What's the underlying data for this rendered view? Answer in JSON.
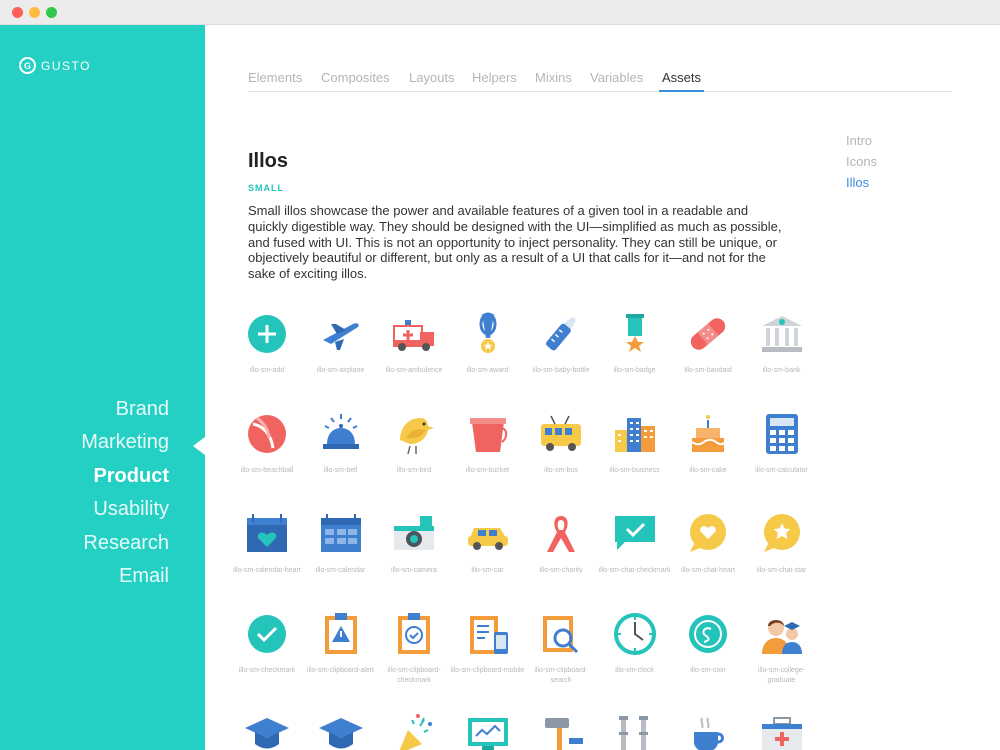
{
  "window": {
    "title": ""
  },
  "sidebar": {
    "logo_mark": "G",
    "logo_text": "GUSTO",
    "nav": [
      {
        "label": "Brand",
        "active": false
      },
      {
        "label": "Marketing",
        "active": false
      },
      {
        "label": "Product",
        "active": true
      },
      {
        "label": "Usability",
        "active": false
      },
      {
        "label": "Research",
        "active": false
      },
      {
        "label": "Email",
        "active": false
      }
    ]
  },
  "tabs": [
    {
      "label": "Elements",
      "active": false
    },
    {
      "label": "Composites",
      "active": false
    },
    {
      "label": "Layouts",
      "active": false
    },
    {
      "label": "Helpers",
      "active": false
    },
    {
      "label": "Mixins",
      "active": false
    },
    {
      "label": "Variables",
      "active": false
    },
    {
      "label": "Assets",
      "active": true
    }
  ],
  "right_nav": [
    {
      "label": "Intro",
      "active": false
    },
    {
      "label": "Icons",
      "active": false
    },
    {
      "label": "Illos",
      "active": true
    }
  ],
  "main": {
    "title": "Illos",
    "subtitle": "SMALL",
    "description": "Small illos showcase the power and available features of a given tool in a readable and quickly digestible way. They should be designed with the UI—simplified as much as possible, and fused with UI. This is not an opportunity to inject personality. They can still be unique, or objectively beautiful or different, but only as a result of a UI that calls for it—and not for the sake of exciting illos."
  },
  "colors": {
    "sidebar": "#24d0c4",
    "accent_blue": "#3a8ee0",
    "teal": "#24c4bb",
    "blue": "#3f7fd0",
    "red": "#f0635f",
    "yellow": "#f7c948",
    "orange": "#f39c3c",
    "gray": "#cfd4d8"
  },
  "illos": [
    {
      "label": "illo-sm-add",
      "icon": "add-icon"
    },
    {
      "label": "illo-sm-airplane",
      "icon": "airplane-icon"
    },
    {
      "label": "illo-sm-ambulence",
      "icon": "ambulance-icon"
    },
    {
      "label": "illo-sm-award",
      "icon": "award-icon"
    },
    {
      "label": "illo-sm-baby-bottle",
      "icon": "baby-bottle-icon"
    },
    {
      "label": "illo-sm-badge",
      "icon": "badge-icon"
    },
    {
      "label": "illo-sm-bandaid",
      "icon": "bandaid-icon"
    },
    {
      "label": "illo-sm-bank",
      "icon": "bank-icon"
    },
    {
      "label": "illo-sm-beachball",
      "icon": "beachball-icon"
    },
    {
      "label": "illo-sm-bell",
      "icon": "bell-icon"
    },
    {
      "label": "illo-sm-bird",
      "icon": "bird-icon"
    },
    {
      "label": "illo-sm-bucket",
      "icon": "bucket-icon"
    },
    {
      "label": "illo-sm-bus",
      "icon": "bus-icon"
    },
    {
      "label": "illo-sm-business",
      "icon": "business-icon"
    },
    {
      "label": "illo-sm-cake",
      "icon": "cake-icon"
    },
    {
      "label": "illo-sm-calculator",
      "icon": "calculator-icon"
    },
    {
      "label": "illo-sm-calendar-heart",
      "icon": "calendar-heart-icon"
    },
    {
      "label": "illo-sm-calendar",
      "icon": "calendar-icon"
    },
    {
      "label": "illo-sm-camera",
      "icon": "camera-icon"
    },
    {
      "label": "illo-sm-car",
      "icon": "car-icon"
    },
    {
      "label": "illo-sm-charity",
      "icon": "charity-ribbon-icon"
    },
    {
      "label": "illo-sm-chat-checkmark",
      "icon": "chat-checkmark-icon"
    },
    {
      "label": "illo-sm-chat-heart",
      "icon": "chat-heart-icon"
    },
    {
      "label": "illo-sm-chat-star",
      "icon": "chat-star-icon"
    },
    {
      "label": "illo-sm-checkmark",
      "icon": "checkmark-icon"
    },
    {
      "label": "illo-sm-clipboard-alert",
      "icon": "clipboard-alert-icon"
    },
    {
      "label": "illo-sm-clipboard-checkmark",
      "icon": "clipboard-checkmark-icon"
    },
    {
      "label": "illo-sm-clipboard-mobile",
      "icon": "clipboard-mobile-icon"
    },
    {
      "label": "illo-sm-clipboard-search",
      "icon": "clipboard-search-icon"
    },
    {
      "label": "illo-sm-clock",
      "icon": "clock-icon"
    },
    {
      "label": "illo-sm-coin",
      "icon": "coin-icon"
    },
    {
      "label": "illo-sm-college-graduate",
      "icon": "college-graduate-icon"
    },
    {
      "label": "",
      "icon": "graduation-cap-icon"
    },
    {
      "label": "",
      "icon": "graduation-cap-icon"
    },
    {
      "label": "",
      "icon": "confetti-icon"
    },
    {
      "label": "",
      "icon": "monitor-icon"
    },
    {
      "label": "",
      "icon": "hammer-icon"
    },
    {
      "label": "",
      "icon": "crutches-icon"
    },
    {
      "label": "",
      "icon": "coffee-icon"
    },
    {
      "label": "",
      "icon": "first-aid-kit-icon"
    }
  ]
}
